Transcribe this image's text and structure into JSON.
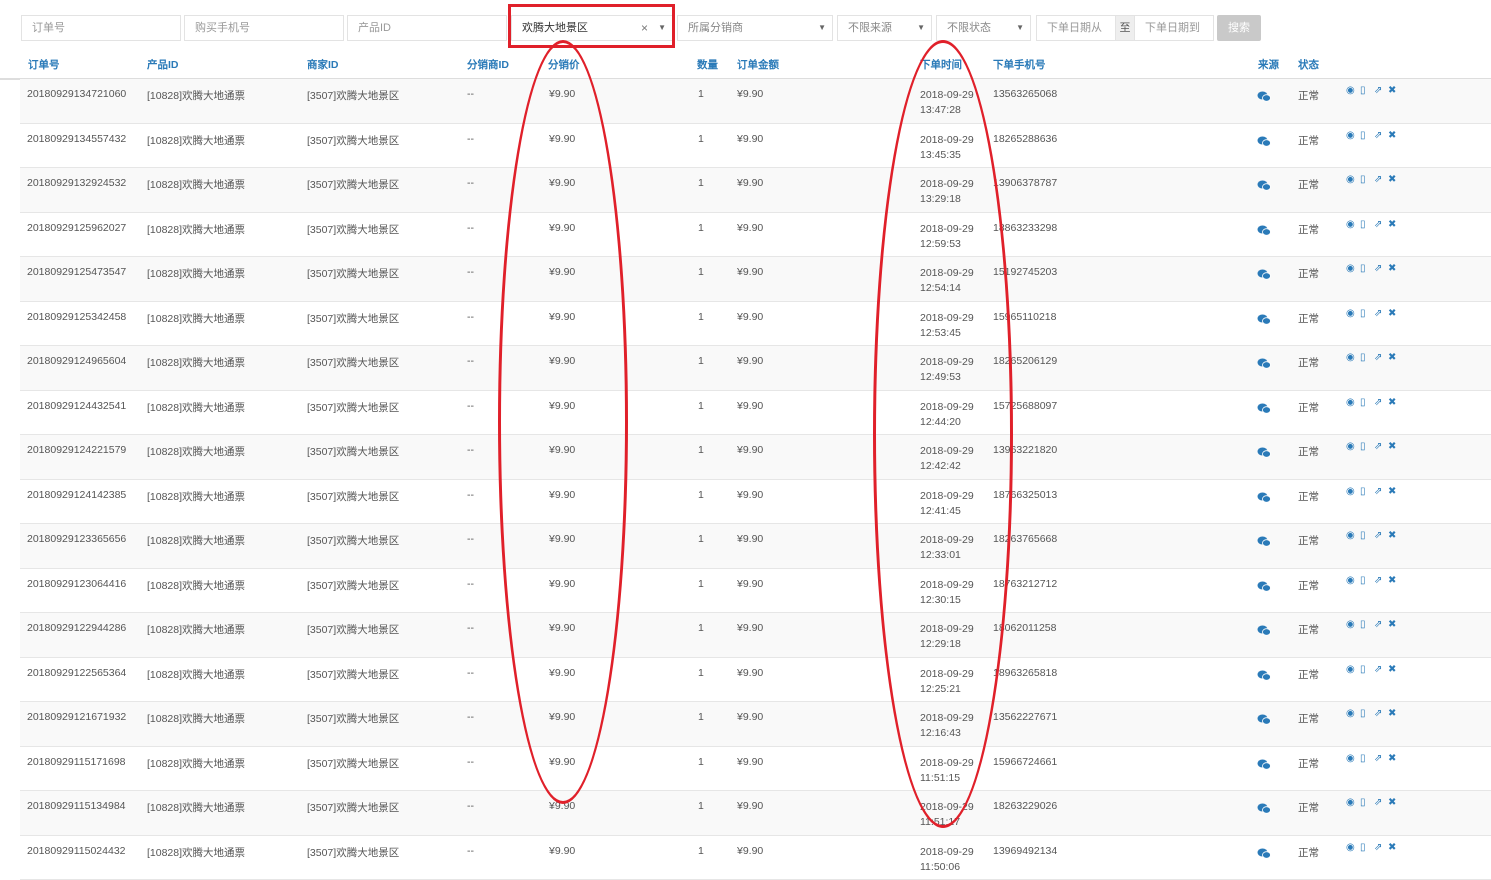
{
  "filters": {
    "order_no_placeholder": "订单号",
    "phone_placeholder": "购买手机号",
    "product_id_placeholder": "产品ID",
    "scenic_selected": "欢腾大地景区",
    "distributor_placeholder": "所属分销商",
    "source_placeholder": "不限来源",
    "status_placeholder": "不限状态",
    "date_from_placeholder": "下单日期从",
    "date_sep": "至",
    "date_to_placeholder": "下单日期到",
    "search_label": "搜索"
  },
  "columns": [
    "订单号",
    "产品ID",
    "商家ID",
    "分销商ID",
    "分销价",
    "数量",
    "订单金额",
    "下单时间",
    "下单手机号",
    "来源",
    "状态"
  ],
  "rows": [
    {
      "order": "20180929134721060",
      "product": "[10828]欢腾大地通票",
      "merchant": "[3507]欢腾大地景区",
      "dist": "--",
      "price": "¥9.90",
      "qty": "1",
      "amount": "¥9.90",
      "date": "2018-09-29",
      "time": "13:47:28",
      "phone": "13563265068",
      "status": "正常"
    },
    {
      "order": "20180929134557432",
      "product": "[10828]欢腾大地通票",
      "merchant": "[3507]欢腾大地景区",
      "dist": "--",
      "price": "¥9.90",
      "qty": "1",
      "amount": "¥9.90",
      "date": "2018-09-29",
      "time": "13:45:35",
      "phone": "18265288636",
      "status": "正常"
    },
    {
      "order": "20180929132924532",
      "product": "[10828]欢腾大地通票",
      "merchant": "[3507]欢腾大地景区",
      "dist": "--",
      "price": "¥9.90",
      "qty": "1",
      "amount": "¥9.90",
      "date": "2018-09-29",
      "time": "13:29:18",
      "phone": "13906378787",
      "status": "正常"
    },
    {
      "order": "20180929125962027",
      "product": "[10828]欢腾大地通票",
      "merchant": "[3507]欢腾大地景区",
      "dist": "--",
      "price": "¥9.90",
      "qty": "1",
      "amount": "¥9.90",
      "date": "2018-09-29",
      "time": "12:59:53",
      "phone": "18863233298",
      "status": "正常"
    },
    {
      "order": "20180929125473547",
      "product": "[10828]欢腾大地通票",
      "merchant": "[3507]欢腾大地景区",
      "dist": "--",
      "price": "¥9.90",
      "qty": "1",
      "amount": "¥9.90",
      "date": "2018-09-29",
      "time": "12:54:14",
      "phone": "15192745203",
      "status": "正常"
    },
    {
      "order": "20180929125342458",
      "product": "[10828]欢腾大地通票",
      "merchant": "[3507]欢腾大地景区",
      "dist": "--",
      "price": "¥9.90",
      "qty": "1",
      "amount": "¥9.90",
      "date": "2018-09-29",
      "time": "12:53:45",
      "phone": "15965110218",
      "status": "正常"
    },
    {
      "order": "20180929124965604",
      "product": "[10828]欢腾大地通票",
      "merchant": "[3507]欢腾大地景区",
      "dist": "--",
      "price": "¥9.90",
      "qty": "1",
      "amount": "¥9.90",
      "date": "2018-09-29",
      "time": "12:49:53",
      "phone": "18265206129",
      "status": "正常"
    },
    {
      "order": "20180929124432541",
      "product": "[10828]欢腾大地通票",
      "merchant": "[3507]欢腾大地景区",
      "dist": "--",
      "price": "¥9.90",
      "qty": "1",
      "amount": "¥9.90",
      "date": "2018-09-29",
      "time": "12:44:20",
      "phone": "15725688097",
      "status": "正常"
    },
    {
      "order": "20180929124221579",
      "product": "[10828]欢腾大地通票",
      "merchant": "[3507]欢腾大地景区",
      "dist": "--",
      "price": "¥9.90",
      "qty": "1",
      "amount": "¥9.90",
      "date": "2018-09-29",
      "time": "12:42:42",
      "phone": "13963221820",
      "status": "正常"
    },
    {
      "order": "20180929124142385",
      "product": "[10828]欢腾大地通票",
      "merchant": "[3507]欢腾大地景区",
      "dist": "--",
      "price": "¥9.90",
      "qty": "1",
      "amount": "¥9.90",
      "date": "2018-09-29",
      "time": "12:41:45",
      "phone": "18766325013",
      "status": "正常"
    },
    {
      "order": "20180929123365656",
      "product": "[10828]欢腾大地通票",
      "merchant": "[3507]欢腾大地景区",
      "dist": "--",
      "price": "¥9.90",
      "qty": "1",
      "amount": "¥9.90",
      "date": "2018-09-29",
      "time": "12:33:01",
      "phone": "18263765668",
      "status": "正常"
    },
    {
      "order": "20180929123064416",
      "product": "[10828]欢腾大地通票",
      "merchant": "[3507]欢腾大地景区",
      "dist": "--",
      "price": "¥9.90",
      "qty": "1",
      "amount": "¥9.90",
      "date": "2018-09-29",
      "time": "12:30:15",
      "phone": "18763212712",
      "status": "正常"
    },
    {
      "order": "20180929122944286",
      "product": "[10828]欢腾大地通票",
      "merchant": "[3507]欢腾大地景区",
      "dist": "--",
      "price": "¥9.90",
      "qty": "1",
      "amount": "¥9.90",
      "date": "2018-09-29",
      "time": "12:29:18",
      "phone": "18062011258",
      "status": "正常"
    },
    {
      "order": "20180929122565364",
      "product": "[10828]欢腾大地通票",
      "merchant": "[3507]欢腾大地景区",
      "dist": "--",
      "price": "¥9.90",
      "qty": "1",
      "amount": "¥9.90",
      "date": "2018-09-29",
      "time": "12:25:21",
      "phone": "18963265818",
      "status": "正常"
    },
    {
      "order": "20180929121671932",
      "product": "[10828]欢腾大地通票",
      "merchant": "[3507]欢腾大地景区",
      "dist": "--",
      "price": "¥9.90",
      "qty": "1",
      "amount": "¥9.90",
      "date": "2018-09-29",
      "time": "12:16:43",
      "phone": "13562227671",
      "status": "正常"
    },
    {
      "order": "20180929115171698",
      "product": "[10828]欢腾大地通票",
      "merchant": "[3507]欢腾大地景区",
      "dist": "--",
      "price": "¥9.90",
      "qty": "1",
      "amount": "¥9.90",
      "date": "2018-09-29",
      "time": "11:51:15",
      "phone": "15966724661",
      "status": "正常"
    },
    {
      "order": "20180929115134984",
      "product": "[10828]欢腾大地通票",
      "merchant": "[3507]欢腾大地景区",
      "dist": "--",
      "price": "¥9.90",
      "qty": "1",
      "amount": "¥9.90",
      "date": "2018-09-29",
      "time": "11:51:17",
      "phone": "18263229026",
      "status": "正常"
    },
    {
      "order": "20180929115024432",
      "product": "[10828]欢腾大地通票",
      "merchant": "[3507]欢腾大地景区",
      "dist": "--",
      "price": "¥9.90",
      "qty": "1",
      "amount": "¥9.90",
      "date": "2018-09-29",
      "time": "11:50:06",
      "phone": "13969492134",
      "status": "正常"
    }
  ],
  "icons": {
    "source": "wechat-icon",
    "actions": [
      "eye-icon",
      "phone-icon",
      "share-icon",
      "close-icon"
    ]
  },
  "colors": {
    "header_blue": "#2a7ab8",
    "annotation_red": "#e0202a"
  }
}
